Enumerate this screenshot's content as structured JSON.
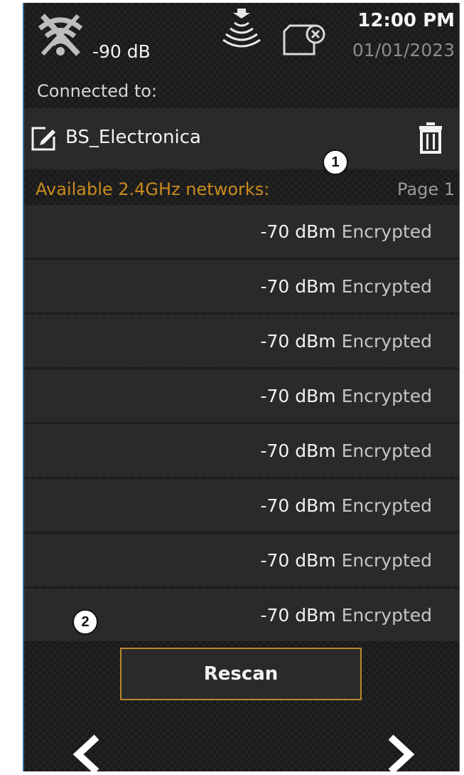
{
  "status_bar": {
    "signal_strength": "-90 dB",
    "time": "12:00 PM",
    "date": "01/01/2023",
    "icons": [
      "wifi-off-icon",
      "antenna-icon",
      "sd-card-error-icon"
    ]
  },
  "connection": {
    "label": "Connected to:",
    "network_name": "BS_Electronica"
  },
  "networks": {
    "label": "Available 2.4GHz networks:",
    "page": "Page 1",
    "items": [
      {
        "strength": "-70 dBm",
        "security": "Encrypted"
      },
      {
        "strength": "-70 dBm",
        "security": "Encrypted"
      },
      {
        "strength": "-70 dBm",
        "security": "Encrypted"
      },
      {
        "strength": "-70 dBm",
        "security": "Encrypted"
      },
      {
        "strength": "-70 dBm",
        "security": "Encrypted"
      },
      {
        "strength": "-70 dBm",
        "security": "Encrypted"
      },
      {
        "strength": "-70 dBm",
        "security": "Encrypted"
      },
      {
        "strength": "-70 dBm",
        "security": "Encrypted"
      }
    ]
  },
  "actions": {
    "rescan_label": "Rescan"
  },
  "callouts": {
    "one": "1",
    "two": "2"
  },
  "colors": {
    "accent": "#c98b1f",
    "row_background": "#2a2a2a"
  }
}
